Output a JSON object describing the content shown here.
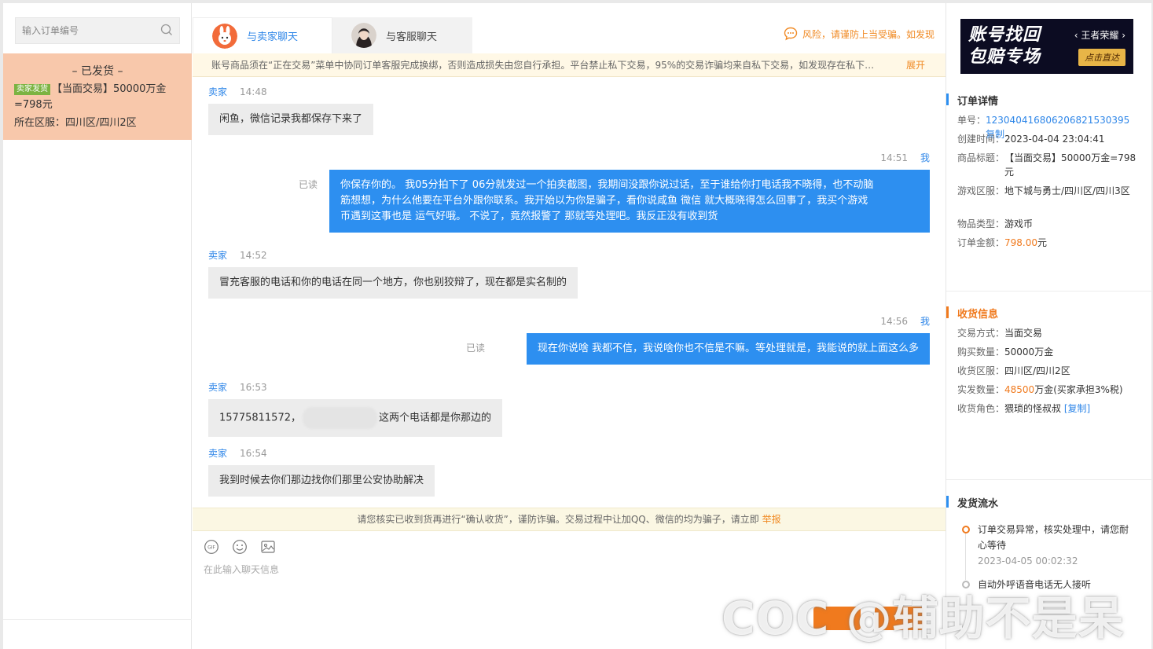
{
  "left": {
    "search_placeholder": "输入订单编号",
    "order": {
      "status": "– 已发货 –",
      "tag": "卖家发货",
      "title": "【当面交易】50000万金=798元",
      "region": "所在区服：四川区/四川2区"
    }
  },
  "tabs": {
    "seller": "与卖家聊天",
    "service": "与客服聊天"
  },
  "risk_text": "风险，请谨防上当受骗。如发现",
  "notice": {
    "text": "账号商品须在“正在交易”菜单中协同订单客服完成换绑，否则造成损失由您自行承担。平台禁止私下交易，95%的交易诈骗均来自私下交易，如发现存在私下加…",
    "expand": "展开"
  },
  "messages": [
    {
      "side": "left",
      "sender": "卖家",
      "time": "14:48",
      "text": "闲鱼，微信记录我都保存下来了"
    },
    {
      "side": "right",
      "sender": "我",
      "time": "14:51",
      "read": "已读",
      "lines": [
        "你保存你的。 我05分拍下了 06分就发过一个拍卖截图，我期间没跟你说过话，至于谁给你打电话我不晓得，也不动脑",
        "筋想想，为什么他要在平台外跟你联系。我开始以为你是骗子，看你说咸鱼  微信 就大概晓得怎么回事了，我买个游戏",
        "币遇到这事也是 运气好哦。 不说了，竟然报警了 那就等处理吧。我反正没有收到货"
      ]
    },
    {
      "side": "left",
      "sender": "卖家",
      "time": "14:52",
      "text": "冒充客服的电话和你的电话在同一个地方，你也别狡辩了，现在都是实名制的"
    },
    {
      "side": "right",
      "sender": "我",
      "time": "14:56",
      "read": "已读",
      "text": "现在你说啥 我都不信，我说啥你也不信是不嘛。等处理就是，我能说的就上面这么多"
    },
    {
      "side": "left",
      "sender": "卖家",
      "time": "16:53",
      "text_a": "15775811572，",
      "text_b": "这两个电话都是你那边的"
    },
    {
      "side": "left",
      "sender": "卖家",
      "time": "16:54",
      "text": "我到时候去你们那边找你们那里公安协助解决"
    }
  ],
  "bottom_notice": {
    "text": "请您核实已收到货再进行“确认收货”，谨防诈骗。交易过程中让加QQ、微信的均为骗子，请立即",
    "report": "举报"
  },
  "input_placeholder": "在此输入聊天信息",
  "banner": {
    "main_line1": "账号找回",
    "main_line2": "包赔专场",
    "game": "‹ 王者荣耀 ›",
    "button": "点击直达"
  },
  "order_detail": {
    "title": "订单详情",
    "order_no_label": "单号：",
    "order_no": "1230404168062068215303​95",
    "copy": "复制",
    "created_label": "创建时间：",
    "created": "2023-04-04 23:04:41",
    "product_label": "商品标题：",
    "product": "【当面交易】50000万金=798元",
    "server_label": "游戏区服：",
    "server": "地下城与勇士/四川区/四川3区",
    "type_label": "物品类型：",
    "type": "游戏币",
    "amount_label": "订单金额：",
    "amount": "798.00",
    "amount_unit": "元"
  },
  "receive_info": {
    "title": "收货信息",
    "mode_label": "交易方式：",
    "mode": "当面交易",
    "qty_label": "购买数量：",
    "qty": "50000万金",
    "area_label": "收货区服：",
    "area": "四川区/四川2区",
    "actual_label": "实发数量：",
    "actual_num": "48500",
    "actual_suffix": "万金(买家承担3%税)",
    "role_label": "收货角色：",
    "role": "猥琐的怪叔叔",
    "copy": "[复制]"
  },
  "flow": {
    "title": "发货流水",
    "items": [
      {
        "text": "订单交易异常，核实处理中，请您耐心等待",
        "time": "2023-04-05 00:02:32"
      },
      {
        "text": "自动外呼语音电话无人接听",
        "time": ""
      }
    ]
  },
  "watermark": "COC @辅助不是呆",
  "colors": {
    "accent": "#2d8ff0",
    "orange": "#f07a1e",
    "order_card": "#f8c8ab"
  }
}
